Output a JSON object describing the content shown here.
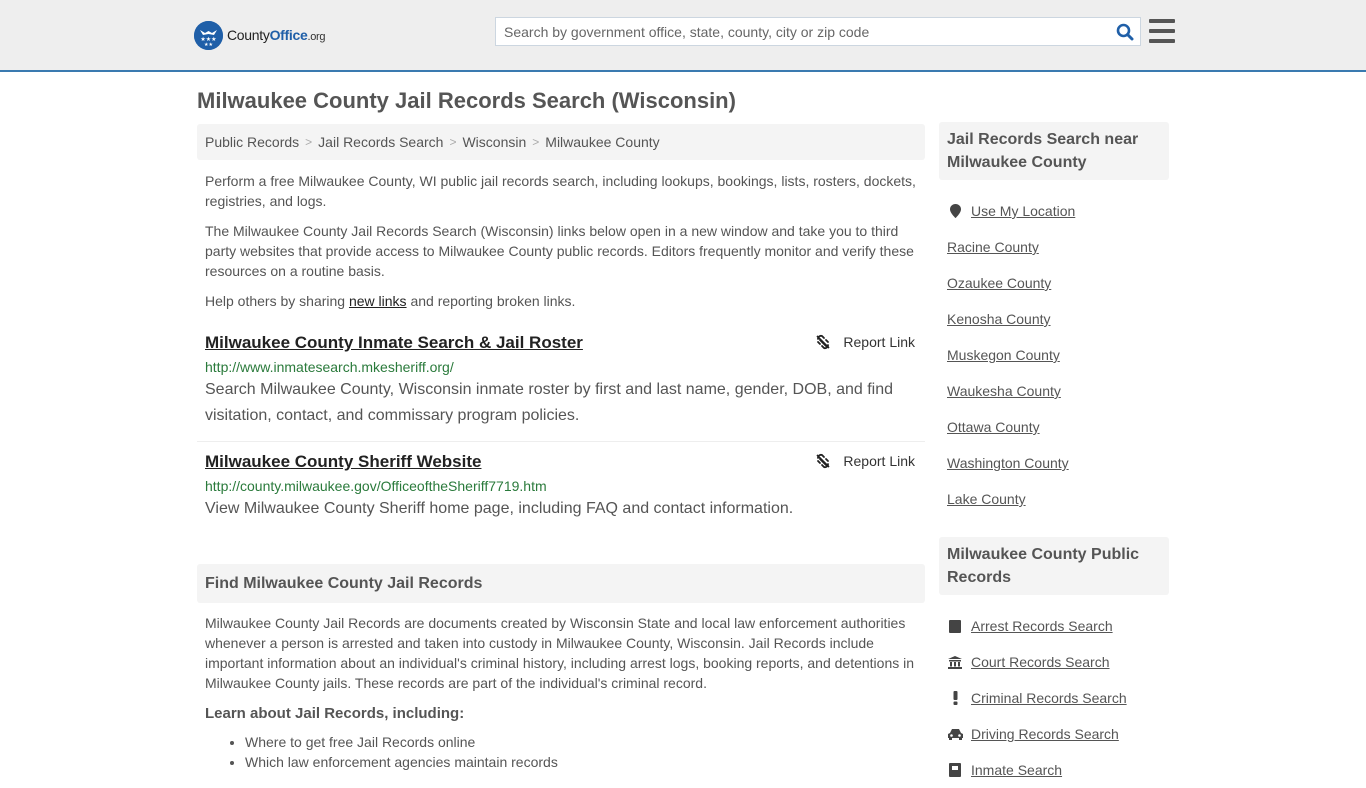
{
  "header": {
    "logo": {
      "text_main": "County",
      "text_brand": "Office",
      "text_tld": ".org"
    },
    "search": {
      "placeholder": "Search by government office, state, county, city or zip code",
      "value": ""
    },
    "search_icon": "search-icon",
    "menu_icon": "hamburger-menu-icon"
  },
  "page": {
    "title": "Milwaukee County Jail Records Search (Wisconsin)",
    "breadcrumb": [
      "Public Records",
      "Jail Records Search",
      "Wisconsin",
      "Milwaukee County"
    ],
    "breadcrumb_separator": ">",
    "intro": {
      "p1": "Perform a free Milwaukee County, WI public jail records search, including lookups, bookings, lists, rosters, dockets, registries, and logs.",
      "p2": "The Milwaukee County Jail Records Search (Wisconsin) links below open in a new window and take you to third party websites that provide access to Milwaukee County public records. Editors frequently monitor and verify these resources on a routine basis.",
      "p3_before": "Help others by sharing ",
      "p3_link": "new links",
      "p3_after": " and reporting broken links."
    },
    "results": [
      {
        "title": "Milwaukee County Inmate Search & Jail Roster",
        "url": "http://www.inmatesearch.mkesheriff.org/",
        "description": "Search Milwaukee County, Wisconsin inmate roster by first and last name, gender, DOB, and find visitation, contact, and commissary program policies.",
        "report_label": "Report Link"
      },
      {
        "title": "Milwaukee County Sheriff Website",
        "url": "http://county.milwaukee.gov/OfficeoftheSheriff7719.htm",
        "description": "View Milwaukee County Sheriff home page, including FAQ and contact information.",
        "report_label": "Report Link"
      }
    ],
    "find_section": {
      "heading": "Find Milwaukee County Jail Records",
      "body": "Milwaukee County Jail Records are documents created by Wisconsin State and local law enforcement authorities whenever a person is arrested and taken into custody in Milwaukee County, Wisconsin. Jail Records include important information about an individual's criminal history, including arrest logs, booking reports, and detentions in Milwaukee County jails. These records are part of the individual's criminal record.",
      "learn_heading": "Learn about Jail Records, including:",
      "learn_items": [
        "Where to get free Jail Records online",
        "Which law enforcement agencies maintain records"
      ]
    }
  },
  "sidebar": {
    "nearby": {
      "heading": "Jail Records Search near Milwaukee County",
      "use_location": "Use My Location",
      "counties": [
        "Racine County",
        "Ozaukee County",
        "Kenosha County",
        "Muskegon County",
        "Waukesha County",
        "Ottawa County",
        "Washington County",
        "Lake County"
      ]
    },
    "public_records": {
      "heading": "Milwaukee County Public Records",
      "items": [
        {
          "label": "Arrest Records Search",
          "icon": "book-icon"
        },
        {
          "label": "Court Records Search",
          "icon": "courthouse-icon"
        },
        {
          "label": "Criminal Records Search",
          "icon": "exclamation-icon"
        },
        {
          "label": "Driving Records Search",
          "icon": "car-icon"
        },
        {
          "label": "Inmate Search",
          "icon": "inmate-icon"
        }
      ]
    }
  },
  "colors": {
    "brand_blue": "#1f5fa8",
    "header_border": "#3a7ab0",
    "url_green": "#2a7a3b",
    "panel_gray": "#f4f4f4"
  }
}
